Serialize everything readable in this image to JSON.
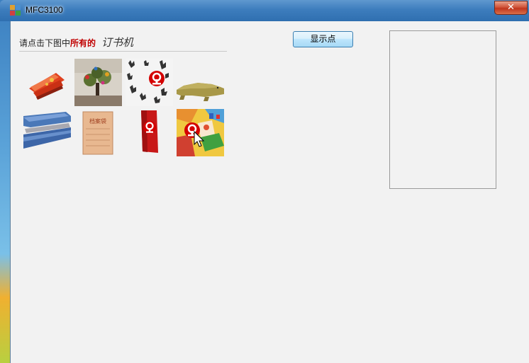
{
  "window": {
    "title": "MFC3100",
    "close_label": "✕"
  },
  "prompt": {
    "prefix": "请点击下图中",
    "highlight": "所有的",
    "target_image_text": "订书机"
  },
  "show_button": {
    "label": "显示点"
  },
  "grid": {
    "tiles": [
      {
        "subject": "red stapler",
        "row": 1,
        "col": 1
      },
      {
        "subject": "decorated tree",
        "row": 1,
        "col": 2
      },
      {
        "subject": "hand prints pattern",
        "row": 1,
        "col": 3
      },
      {
        "subject": "crocodile",
        "row": 1,
        "col": 4
      },
      {
        "subject": "blue stapler",
        "row": 2,
        "col": 1
      },
      {
        "subject": "archive envelope",
        "row": 2,
        "col": 2,
        "text": "档案袋"
      },
      {
        "subject": "red banner",
        "row": 2,
        "col": 3
      },
      {
        "subject": "cartoon collage",
        "row": 2,
        "col": 4
      }
    ]
  },
  "colors": {
    "titlebar": "#3d7dbd",
    "client_bg": "#f2f2f2",
    "highlight_text": "#c00000",
    "rail_logo": "#d40000"
  }
}
